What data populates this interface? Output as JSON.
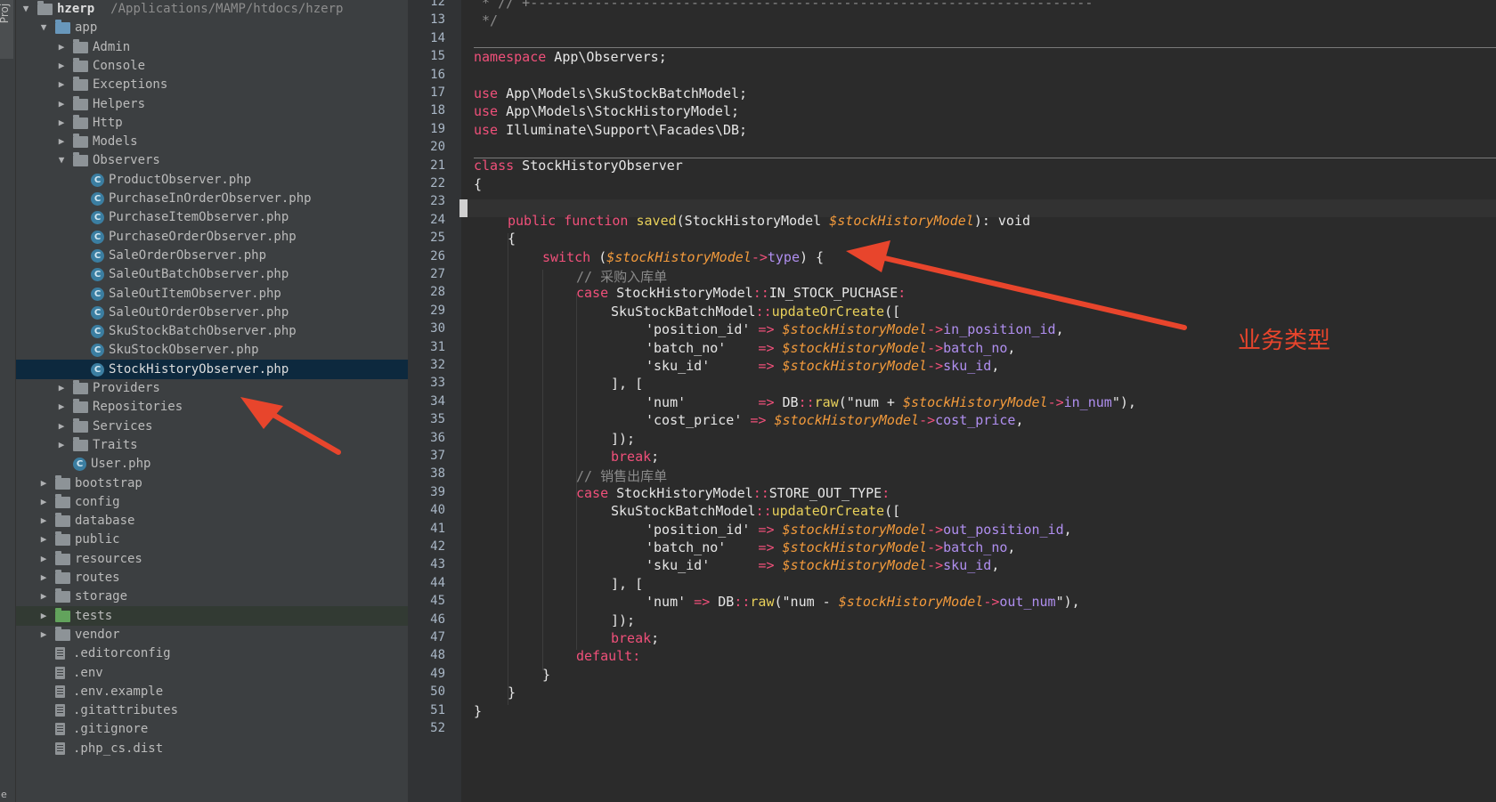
{
  "project_strip": {
    "tab_label": "Proj",
    "bottom_label": "e"
  },
  "tree": {
    "root": {
      "name": "hzerp",
      "path": "/Applications/MAMP/htdocs/hzerp"
    },
    "app": "app",
    "app_children": [
      "Admin",
      "Console",
      "Exceptions",
      "Helpers",
      "Http",
      "Models"
    ],
    "observers_folder": "Observers",
    "observer_files": [
      "ProductObserver.php",
      "PurchaseInOrderObserver.php",
      "PurchaseItemObserver.php",
      "PurchaseOrderObserver.php",
      "SaleOrderObserver.php",
      "SaleOutBatchObserver.php",
      "SaleOutItemObserver.php",
      "SaleOutOrderObserver.php",
      "SkuStockBatchObserver.php",
      "SkuStockObserver.php",
      "StockHistoryObserver.php"
    ],
    "app_after": [
      "Providers",
      "Repositories",
      "Services",
      "Traits"
    ],
    "user_file": "User.php",
    "top_folders": [
      "bootstrap",
      "config",
      "database",
      "public",
      "resources",
      "routes",
      "storage",
      "tests",
      "vendor"
    ],
    "dot_files": [
      ".editorconfig",
      ".env",
      ".env.example",
      ".gitattributes",
      ".gitignore",
      ".php_cs.dist"
    ],
    "class_icon_letter": "C"
  },
  "editor": {
    "line_numbers": [
      "12",
      "13",
      "14",
      "15",
      "16",
      "17",
      "18",
      "19",
      "20",
      "21",
      "22",
      "23",
      "24",
      "25",
      "26",
      "27",
      "28",
      "29",
      "30",
      "31",
      "32",
      "33",
      "34",
      "35",
      "36",
      "37",
      "38",
      "39",
      "40",
      "41",
      "42",
      "43",
      "44",
      "45",
      "46",
      "47",
      "48",
      "49",
      "50",
      "51",
      "52"
    ],
    "code": {
      "l12": " * // +----------------------------------------------------------------------",
      "l13": " */",
      "l15_kw": "namespace",
      "l15_rest": " App\\Observers;",
      "use_kw": "use",
      "l17_rest": " App\\Models\\SkuStockBatchModel;",
      "l18_rest": " App\\Models\\StockHistoryModel;",
      "l19_rest": " Illuminate\\Support\\Facades\\DB;",
      "class_kw": "class",
      "class_name": " StockHistoryObserver",
      "open_brace": "{",
      "close_brace": "}",
      "public_function": "public function ",
      "saved": "saved",
      "saved_param_type": "(StockHistoryModel ",
      "saved_var": "$stockHistoryModel",
      "saved_ret": "): void",
      "switch_kw": "switch",
      "switch_open": " (",
      "switch_var": "$stockHistoryModel",
      "arrow": "->",
      "type_prop": "type",
      "switch_close": ") {",
      "comment_purchase": "// 采购入库单",
      "case_kw": "case",
      "case1_rest": " StockHistoryModel",
      "dcolon": "::",
      "case1_const": "IN_STOCK_PUCHASE",
      "colon": ":",
      "sku_batch": "SkuStockBatchModel",
      "update_or_create": "updateOrCreate",
      "open_arr": "([",
      "key_position": "'position_id'",
      "key_batch": "'batch_no'   ",
      "key_sku": "'sku_id'     ",
      "fat_arrow": " => ",
      "stock_var": "$stockHistoryModel",
      "prop_in_position": "in_position_id",
      "prop_batch": "batch_no",
      "prop_sku": "sku_id",
      "comma": ",",
      "arr_mid": "], [",
      "key_num": "'num'        ",
      "key_num_short": "'num'",
      "db": "DB",
      "raw": "raw",
      "raw_open1": "(\"num + ",
      "prop_in_num": "in_num",
      "raw_close": "\"),",
      "key_cost": "'cost_price'",
      "prop_cost": "cost_price",
      "arr_close": "]);",
      "break_kw": "break",
      "semi": ";",
      "comment_sale": "// 销售出库单",
      "case2_const": "STORE_OUT_TYPE",
      "prop_out_position": "out_position_id",
      "raw_open2": "(\"num - ",
      "prop_out_num": "out_num",
      "default_kw": "default:"
    }
  },
  "annotation": {
    "text": "业务类型",
    "color": "#e8452c"
  }
}
